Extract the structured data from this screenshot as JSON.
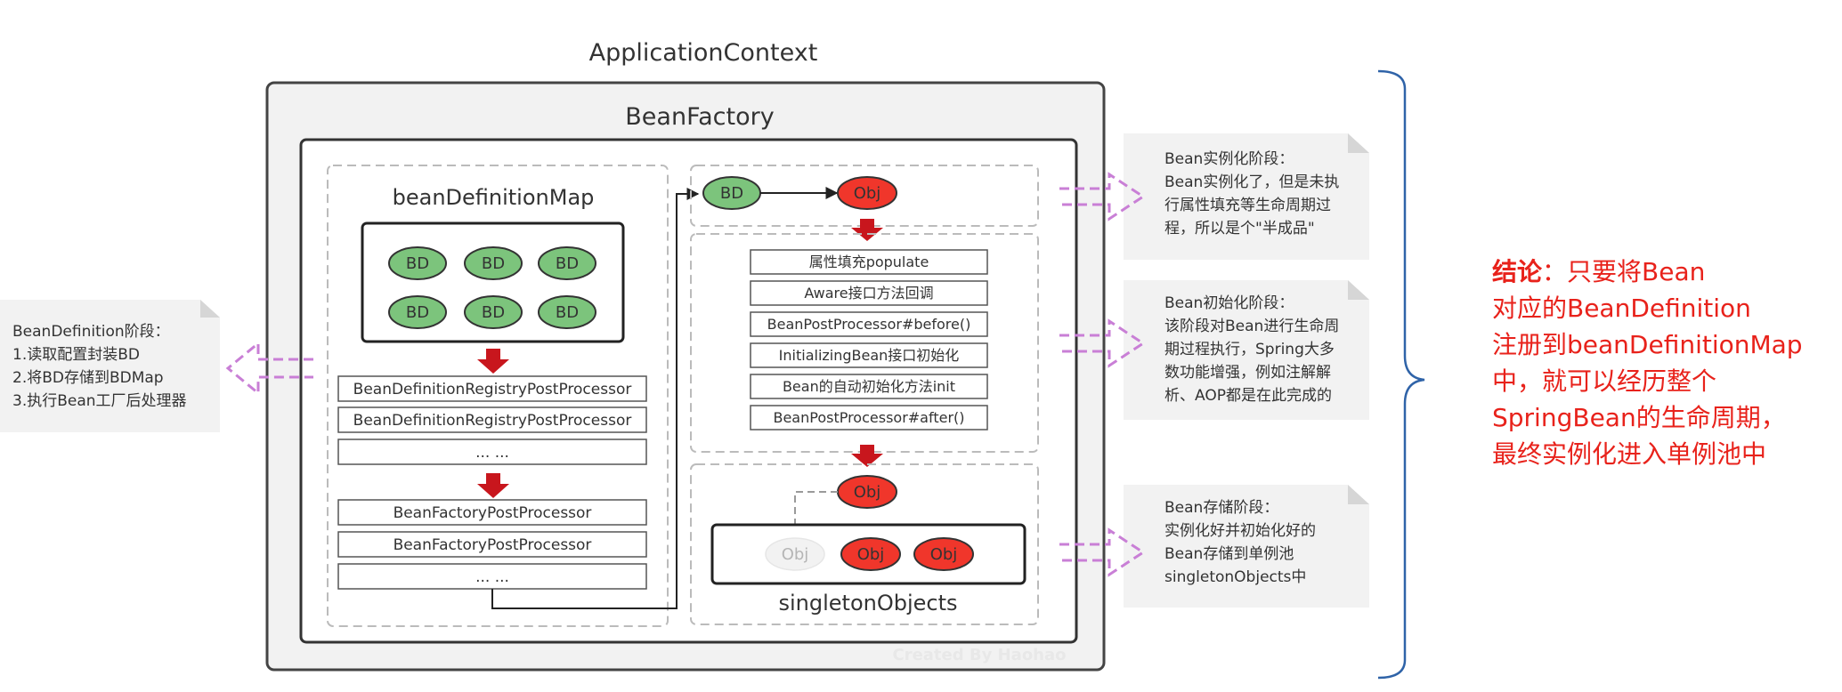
{
  "application_context": {
    "title": "ApplicationContext"
  },
  "bean_factory": {
    "title": "BeanFactory"
  },
  "bean_definition_map": {
    "title": "beanDefinitionMap",
    "items": [
      "BD",
      "BD",
      "BD",
      "BD",
      "BD",
      "BD"
    ]
  },
  "registry_processors": [
    "BeanDefinitionRegistryPostProcessor",
    "BeanDefinitionRegistryPostProcessor",
    "... ..."
  ],
  "factory_processors": [
    "BeanFactoryPostProcessor",
    "BeanFactoryPostProcessor",
    "... ..."
  ],
  "instantiation": {
    "bd_label": "BD",
    "obj_label": "Obj"
  },
  "init_steps": [
    "属性填充populate",
    "Aware接口方法回调",
    "BeanPostProcessor#before()",
    "InitializingBean接口初始化",
    "Bean的自动初始化方法init",
    "BeanPostProcessor#after()"
  ],
  "singleton": {
    "incoming_obj": "Obj",
    "ghost_obj": "Obj",
    "objs": [
      "Obj",
      "Obj"
    ],
    "title": "singletonObjects"
  },
  "watermark": "Created By Haohao",
  "notes": {
    "left": [
      "BeanDefinition阶段：",
      "1.读取配置封装BD",
      "2.将BD存储到BDMap",
      "3.执行Bean工厂后处理器"
    ],
    "instantiate": [
      "Bean实例化阶段：",
      "Bean实例化了，但是未执",
      "行属性填充等生命周期过",
      "程，所以是个\"半成品\""
    ],
    "initialize": [
      "Bean初始化阶段：",
      "该阶段对Bean进行生命周",
      "期过程执行，Spring大多",
      "数功能增强，例如注解解",
      "析、AOP都是在此完成的"
    ],
    "store": [
      "Bean存储阶段：",
      "实例化好并初始化好的",
      "Bean存储到单例池",
      "singletonObjects中"
    ]
  },
  "conclusion": {
    "label": "结论",
    "lines": [
      "：只要将Bean",
      "对应的BeanDefinition",
      "注册到beanDefinitionMap",
      "中，就可以经历整个",
      "SpringBean的生命周期，",
      "最终实例化进入单例池中"
    ]
  },
  "colors": {
    "green": "#7CC47C",
    "red": "#F0362B",
    "arrow_red": "#C8161D",
    "purple": "#C97FD6",
    "note_bg": "#F2F2F2",
    "accent_text": "#E8221B"
  }
}
